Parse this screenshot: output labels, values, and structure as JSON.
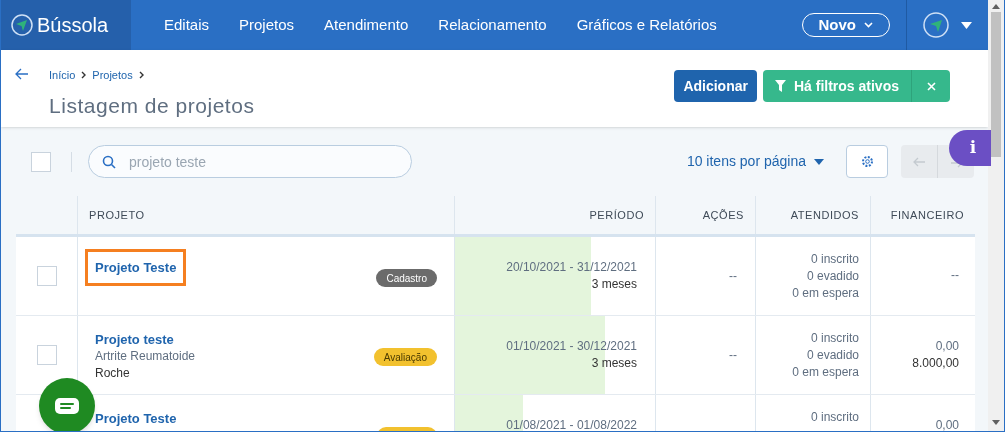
{
  "brand": "Bússola",
  "nav": [
    {
      "label": "Editais"
    },
    {
      "label": "Projetos"
    },
    {
      "label": "Atendimento"
    },
    {
      "label": "Relacionamento"
    },
    {
      "label": "Gráficos e Relatórios"
    }
  ],
  "new_button": "Novo",
  "breadcrumb": [
    "Início",
    "Projetos"
  ],
  "page_title": "Listagem de projetos",
  "add_button": "Adicionar",
  "filter_button": "Há filtros ativos",
  "select_all_checked": false,
  "search": {
    "value": "projeto teste"
  },
  "per_page": "10 itens por página",
  "info_tab": "i",
  "table": {
    "columns": [
      "PROJETO",
      "PERÍODO",
      "AÇÕES",
      "ATENDIDOS",
      "FINANCEIRO"
    ],
    "rows": [
      {
        "checked": false,
        "title": "Projeto Teste",
        "highlighted": true,
        "lines": [],
        "status": {
          "label": "Cadastro",
          "color": "#6b6b6b"
        },
        "period": "20/10/2021 - 31/12/2021",
        "duration": "3 meses",
        "level": 0.68,
        "actions": "--",
        "attended": [
          "0 inscrito",
          "0 evadido",
          "0 em espera"
        ],
        "finance": [
          "--"
        ]
      },
      {
        "checked": false,
        "title": "Projeto teste",
        "highlighted": false,
        "lines": [
          "Artrite Reumatoide",
          "Roche"
        ],
        "status": {
          "label": "Avaliação",
          "color": "#f2c12e"
        },
        "period": "01/10/2021 - 30/12/2021",
        "duration": "3 meses",
        "level": 0.75,
        "actions": "--",
        "attended": [
          "0 inscrito",
          "0 evadido",
          "0 em espera"
        ],
        "finance": [
          "0,00",
          "8.000,00"
        ]
      },
      {
        "title": "Projeto Teste",
        "highlighted": false,
        "lines": [],
        "status": {
          "color": "#f2c12e"
        },
        "period": "01/08/2021 - 01/08/2022",
        "level": 0.34,
        "attended": [
          "0 inscrito"
        ],
        "finance": [
          "0,00"
        ]
      }
    ]
  }
}
